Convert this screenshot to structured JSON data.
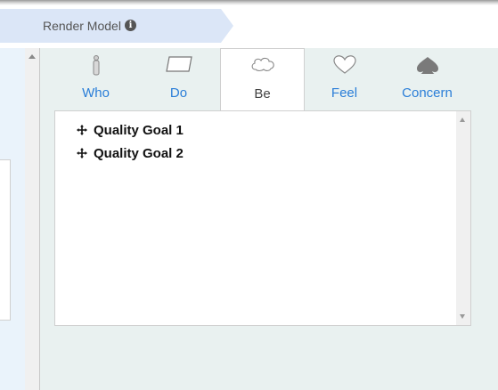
{
  "breadcrumb": {
    "label": "Render Model",
    "info_icon": "info-circle-icon"
  },
  "tabs": [
    {
      "label": "Who",
      "icon": "person-icon",
      "active": false
    },
    {
      "label": "Do",
      "icon": "parallelogram-icon",
      "active": false
    },
    {
      "label": "Be",
      "icon": "cloud-icon",
      "active": true
    },
    {
      "label": "Feel",
      "icon": "heart-icon",
      "active": false
    },
    {
      "label": "Concern",
      "icon": "spade-icon",
      "active": false
    }
  ],
  "goals": [
    {
      "label": "Quality Goal 1",
      "icon": "move-icon"
    },
    {
      "label": "Quality Goal 2",
      "icon": "move-icon"
    }
  ],
  "colors": {
    "tab_link": "#2a7ed8",
    "breadcrumb_bg": "#dbe6f7",
    "panel_bg": "#e9f1f0"
  }
}
